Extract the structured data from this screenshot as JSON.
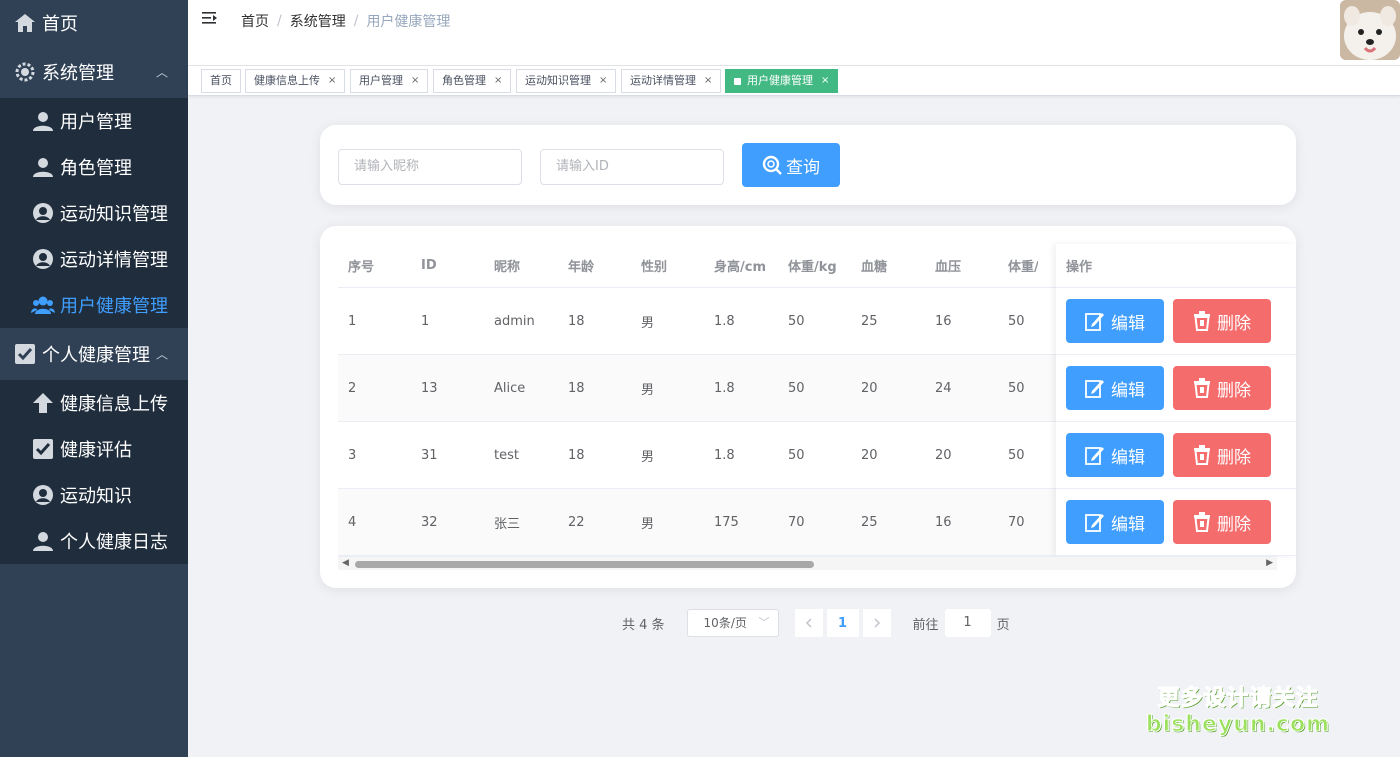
{
  "sidebar": {
    "home": "首页",
    "system": {
      "title": "系统管理",
      "items": [
        "用户管理",
        "角色管理",
        "运动知识管理",
        "运动详情管理",
        "用户健康管理"
      ]
    },
    "personal": {
      "title": "个人健康管理",
      "items": [
        "健康信息上传",
        "健康评估",
        "运动知识",
        "个人健康日志"
      ]
    }
  },
  "breadcrumb": [
    "首页",
    "系统管理",
    "用户健康管理"
  ],
  "tags": [
    {
      "label": "首页",
      "closable": false,
      "active": false
    },
    {
      "label": "健康信息上传",
      "closable": true,
      "active": false
    },
    {
      "label": "用户管理",
      "closable": true,
      "active": false
    },
    {
      "label": "角色管理",
      "closable": true,
      "active": false
    },
    {
      "label": "运动知识管理",
      "closable": true,
      "active": false
    },
    {
      "label": "运动详情管理",
      "closable": true,
      "active": false
    },
    {
      "label": "用户健康管理",
      "closable": true,
      "active": true
    }
  ],
  "tag_close_glyph": "×",
  "search": {
    "nickname_placeholder": "请输入昵称",
    "id_placeholder": "请输入ID",
    "button": "查询"
  },
  "table": {
    "columns": [
      "序号",
      "ID",
      "昵称",
      "年龄",
      "性别",
      "身高/cm",
      "体重/kg",
      "血糖",
      "血压",
      "体重/"
    ],
    "action_header": "操作",
    "rows": [
      [
        "1",
        "1",
        "admin",
        "18",
        "男",
        "1.8",
        "50",
        "25",
        "16",
        "50"
      ],
      [
        "2",
        "13",
        "Alice",
        "18",
        "男",
        "1.8",
        "50",
        "20",
        "24",
        "50"
      ],
      [
        "3",
        "31",
        "test",
        "18",
        "男",
        "1.8",
        "50",
        "20",
        "20",
        "50"
      ],
      [
        "4",
        "32",
        "张三",
        "22",
        "男",
        "175",
        "70",
        "25",
        "16",
        "70"
      ]
    ],
    "edit_label": "编辑",
    "delete_label": "删除"
  },
  "pagination": {
    "total": "共 4 条",
    "page_size": "10条/页",
    "current_page": "1",
    "goto_prefix": "前往",
    "goto_value": "1",
    "goto_suffix": "页"
  },
  "watermark": {
    "line1": "更多设计请关注",
    "line2": "bisheyun.com"
  },
  "colors": {
    "sidebar_bg": "#304156",
    "submenu_bg": "#1f2d3d",
    "active_text": "#409eff",
    "primary": "#409eff",
    "danger": "#f56c6c",
    "active_tag": "#42b983"
  }
}
